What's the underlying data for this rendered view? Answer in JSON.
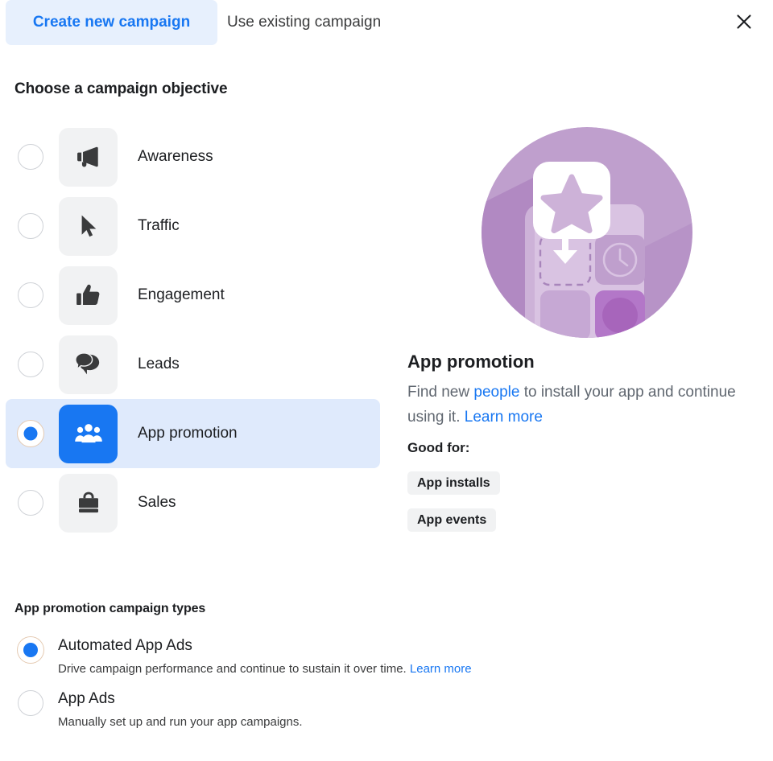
{
  "tabs": [
    {
      "label": "Create new campaign",
      "active": true
    },
    {
      "label": "Use existing campaign",
      "active": false
    }
  ],
  "close_icon": "close-icon",
  "colors": {
    "accent": "#1877f2",
    "tab_active_bg": "#e7f0fd",
    "selected_row_bg": "#dfeafc",
    "icon_box_bg": "#f1f2f3",
    "text_primary": "#1c1e21",
    "text_secondary": "#606770",
    "illustration_circle": "#bd9ecb"
  },
  "objective_section": {
    "title": "Choose a campaign objective",
    "options": [
      {
        "label": "Awareness",
        "icon": "megaphone-icon",
        "selected": false
      },
      {
        "label": "Traffic",
        "icon": "cursor-icon",
        "selected": false
      },
      {
        "label": "Engagement",
        "icon": "thumbs-up-icon",
        "selected": false
      },
      {
        "label": "Leads",
        "icon": "chat-bubbles-icon",
        "selected": false
      },
      {
        "label": "App promotion",
        "icon": "people-group-icon",
        "selected": true
      },
      {
        "label": "Sales",
        "icon": "shopping-bag-icon",
        "selected": false
      }
    ]
  },
  "detail": {
    "illustration": "app-promotion-illustration",
    "title": "App promotion",
    "description_part1": "Find new ",
    "description_link1": "people",
    "description_part2": " to install your app and continue using it. ",
    "description_link2": "Learn more",
    "good_for_label": "Good for:",
    "tags": [
      "App installs",
      "App events"
    ]
  },
  "types_section": {
    "title": "App promotion campaign types",
    "options": [
      {
        "label": "Automated App Ads",
        "desc_text": "Drive campaign performance and continue to sustain it over time. ",
        "desc_link": "Learn more",
        "selected": true
      },
      {
        "label": "App Ads",
        "desc_text": "Manually set up and run your app campaigns.",
        "desc_link": "",
        "selected": false
      }
    ]
  }
}
